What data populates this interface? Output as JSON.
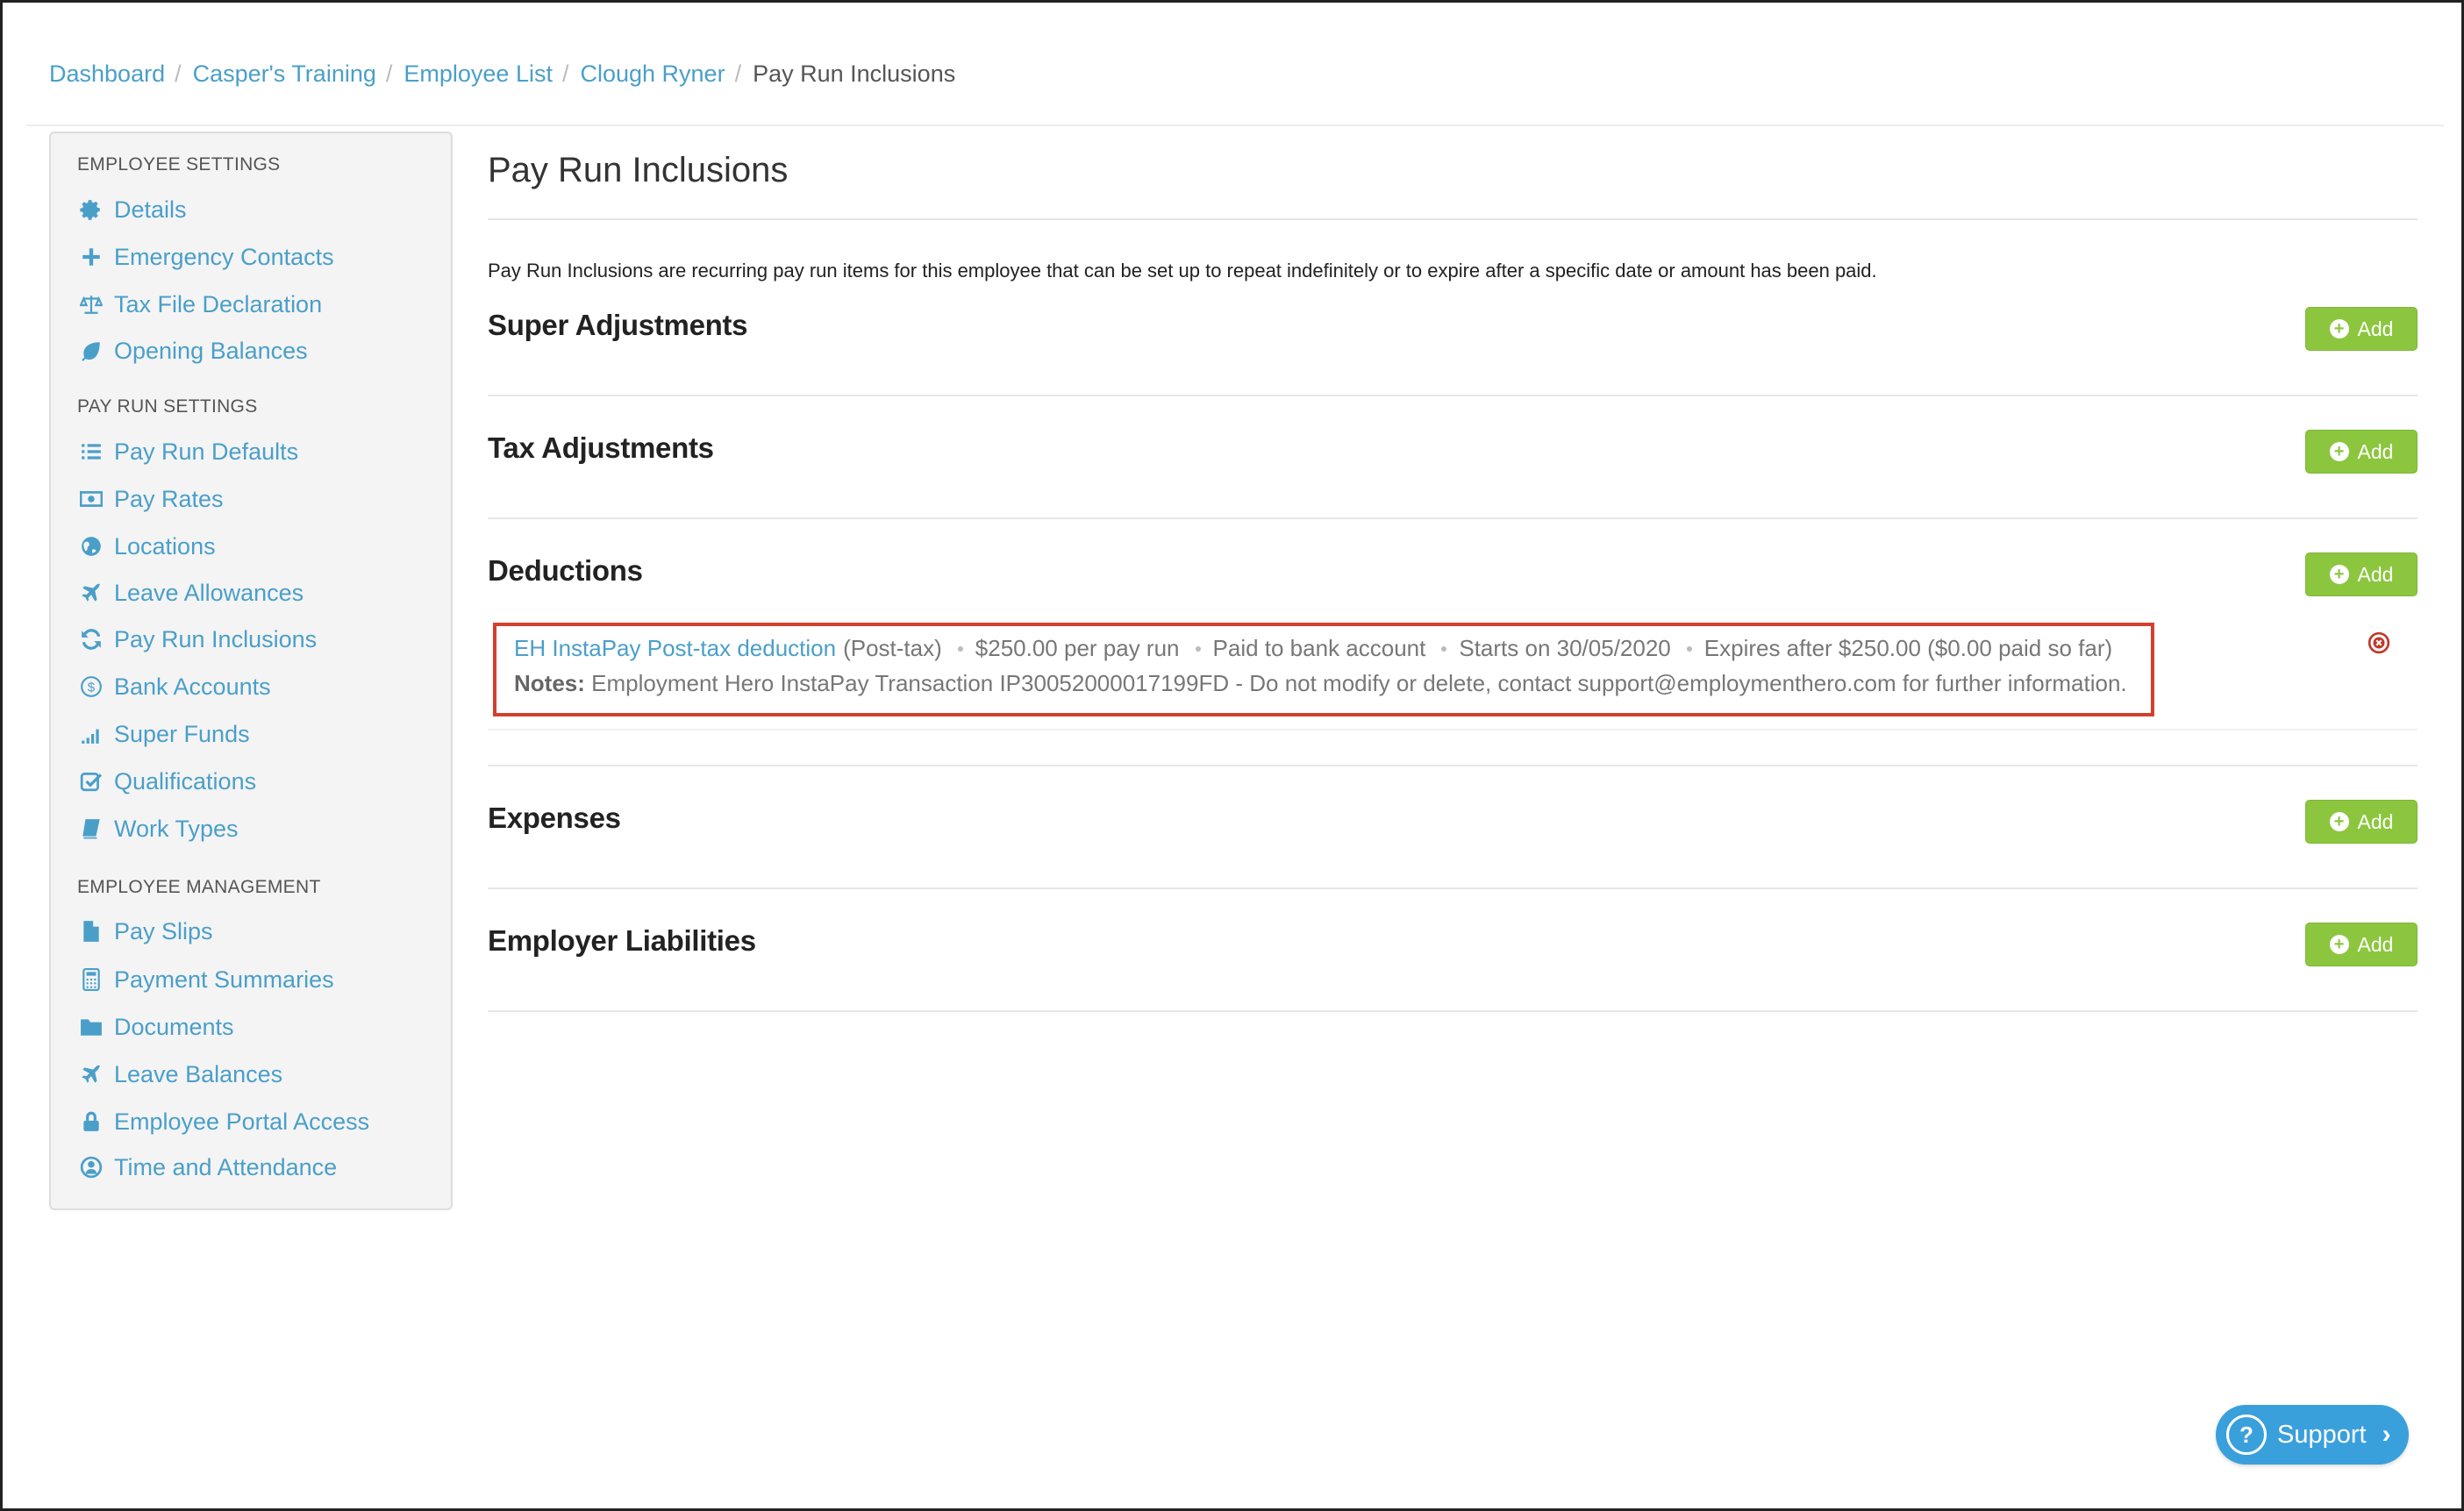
{
  "breadcrumb": {
    "items": [
      "Dashboard",
      "Casper's Training",
      "Employee List",
      "Clough Ryner"
    ],
    "current": "Pay Run Inclusions",
    "separator": "/"
  },
  "sidebar": {
    "sections": [
      {
        "heading": "EMPLOYEE SETTINGS",
        "items": [
          {
            "label": "Details",
            "icon": "gear-icon"
          },
          {
            "label": "Emergency Contacts",
            "icon": "plus-icon"
          },
          {
            "label": "Tax File Declaration",
            "icon": "scale-icon"
          },
          {
            "label": "Opening Balances",
            "icon": "leaf-icon"
          }
        ]
      },
      {
        "heading": "PAY RUN SETTINGS",
        "items": [
          {
            "label": "Pay Run Defaults",
            "icon": "list-icon"
          },
          {
            "label": "Pay Rates",
            "icon": "money-icon"
          },
          {
            "label": "Locations",
            "icon": "globe-icon"
          },
          {
            "label": "Leave Allowances",
            "icon": "plane-icon"
          },
          {
            "label": "Pay Run Inclusions",
            "icon": "refresh-icon"
          },
          {
            "label": "Bank Accounts",
            "icon": "dollar-circle-icon"
          },
          {
            "label": "Super Funds",
            "icon": "signal-icon"
          },
          {
            "label": "Qualifications",
            "icon": "checkbox-icon"
          },
          {
            "label": "Work Types",
            "icon": "book-icon"
          }
        ]
      },
      {
        "heading": "EMPLOYEE MANAGEMENT",
        "items": [
          {
            "label": "Pay Slips",
            "icon": "file-icon"
          },
          {
            "label": "Payment Summaries",
            "icon": "calculator-icon"
          },
          {
            "label": "Documents",
            "icon": "folder-icon"
          },
          {
            "label": "Leave Balances",
            "icon": "plane-icon"
          },
          {
            "label": "Employee Portal Access",
            "icon": "lock-icon"
          },
          {
            "label": "Time and Attendance",
            "icon": "clock-user-icon"
          }
        ]
      }
    ]
  },
  "main": {
    "title": "Pay Run Inclusions",
    "intro": "Pay Run Inclusions are recurring pay run items for this employee that can be set up to repeat indefinitely or to expire after a specific date or amount has been paid.",
    "add_label": "Add",
    "sections": [
      {
        "title": "Super Adjustments"
      },
      {
        "title": "Tax Adjustments"
      },
      {
        "title": "Deductions"
      },
      {
        "title": "Expenses"
      },
      {
        "title": "Employer Liabilities"
      }
    ],
    "deduction": {
      "name": "EH InstaPay Post-tax deduction",
      "type": "(Post-tax)",
      "amount": "$250.00  per pay run",
      "paid_to": "Paid to bank account",
      "starts": "Starts on 30/05/2020",
      "expires": "Expires after $250.00 ($0.00 paid so far)",
      "notes_label": "Notes:",
      "notes": "Employment Hero InstaPay Transaction IP30052000017199FD - Do not modify or delete, contact support@employmenthero.com for further information."
    }
  },
  "support": {
    "label": "Support"
  },
  "colors": {
    "link": "#4a9fc9",
    "add_button": "#8cc63f",
    "highlight_border": "#d2402d",
    "remove_icon": "#c0392b",
    "support_button": "#3aa0dc"
  }
}
